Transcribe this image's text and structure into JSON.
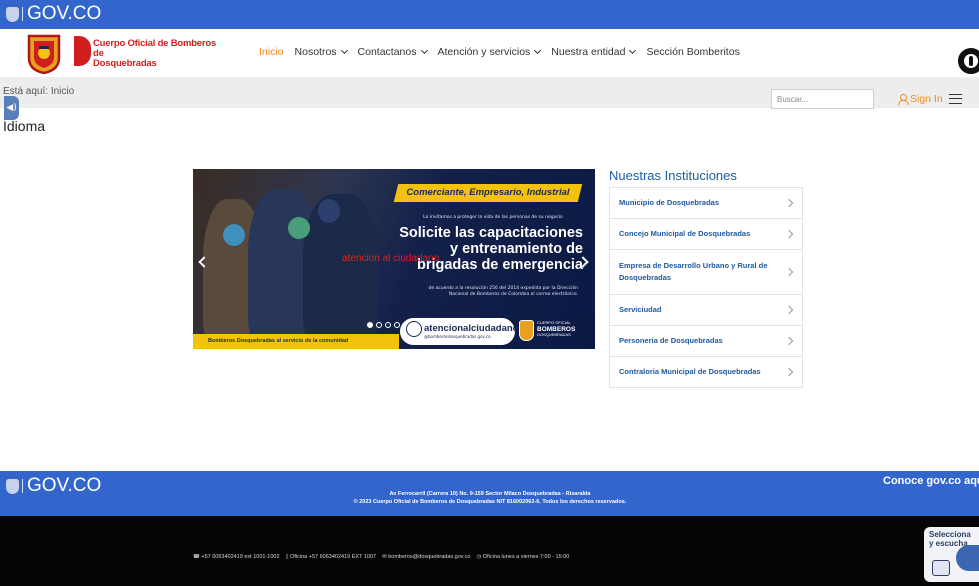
{
  "gov_bar": {
    "logo_text": "GOV.CO"
  },
  "brand": {
    "name_line1": "Cuerpo Oficial de Bomberos de",
    "name_line2": "Dosquebradas"
  },
  "nav": {
    "items": [
      {
        "label": "Inicio",
        "active": true,
        "dropdown": false
      },
      {
        "label": "Nosotros",
        "active": false,
        "dropdown": true
      },
      {
        "label": "Contactanos",
        "active": false,
        "dropdown": true
      },
      {
        "label": "Atención y servicios",
        "active": false,
        "dropdown": true
      },
      {
        "label": "Nuestra entidad",
        "active": false,
        "dropdown": true
      },
      {
        "label": "Sección Bomberitos",
        "active": false,
        "dropdown": false
      }
    ]
  },
  "breadcrumb": {
    "prefix": "Está aquí:",
    "current": "Inicio"
  },
  "search": {
    "placeholder": "Buscar..."
  },
  "signin": {
    "label": "Sign In"
  },
  "language": {
    "label": "Idioma"
  },
  "banner": {
    "tag": "Comerciante, Empresario, Industrial",
    "intro": "Lo invitamos a proteger la vida de las personas de su negocio",
    "headline_line1": "Solicite las capacitaciones",
    "headline_line2": "y entrenamiento de",
    "headline_line3": "brigadas de emergencia",
    "note_line1": "de acuerdo a la resolución 256 del 2014 expedida por la Dirección",
    "note_line2": "Nacional de Bomberos de Colombia al correo electrónico.",
    "email_main": "atencionalciudadano",
    "email_domain": "@bomberosdosquebradas.gov.co",
    "badge_line1": "CUERPO OFICIAL",
    "badge_line2": "BOMBEROS",
    "badge_line3": "DOSQUEBRADAS",
    "bottom_strip": "Bomberos Dosquebradas al servicio de la comunidad",
    "overlay_link": "atencion al ciudadano",
    "slides_total": 4,
    "active_slide": 0
  },
  "institutions": {
    "title": "Nuestras Instituciones",
    "items": [
      "Municipio de Dosquebradas",
      "Concejo Municipal de Dosquebradas",
      "Empresa de Desarrollo Urbano y Rural de Dosquebradas",
      "Serviciudad",
      "Personeria de Dosquebradas",
      "Contraloria Municipal de Dosquebradas"
    ]
  },
  "footer": {
    "logo_text": "GOV.CO",
    "address_line1": "Av Ferrocarril (Carrera 10) No. 9-159 Sector Milaco Dosquebradas - Risaralda",
    "address_line2": "© 2023 Cuerpo Oficial de Bomberos de Dosquebradas NIT 816002062-6. Todos los derechos reservados.",
    "conoce_link": "Conoce gov.co aquí",
    "phone": "+57 6063402419 ext 1001-1002",
    "office_phone": "Oficina +57 6063402419 EXT 1007",
    "email": "bomberos@dosquebradas.gov.co",
    "hours": "Oficina lunes a viernes 7:00 - 15:00"
  },
  "listen_widget": {
    "line1": "Selecciona",
    "line2": "y escucha"
  },
  "colors": {
    "gov_blue": "#3366cc",
    "accent_orange": "#f08a24",
    "brand_red": "#d11e1e",
    "banner_yellow": "#f2c20f",
    "link_blue": "#1e5aa0"
  }
}
